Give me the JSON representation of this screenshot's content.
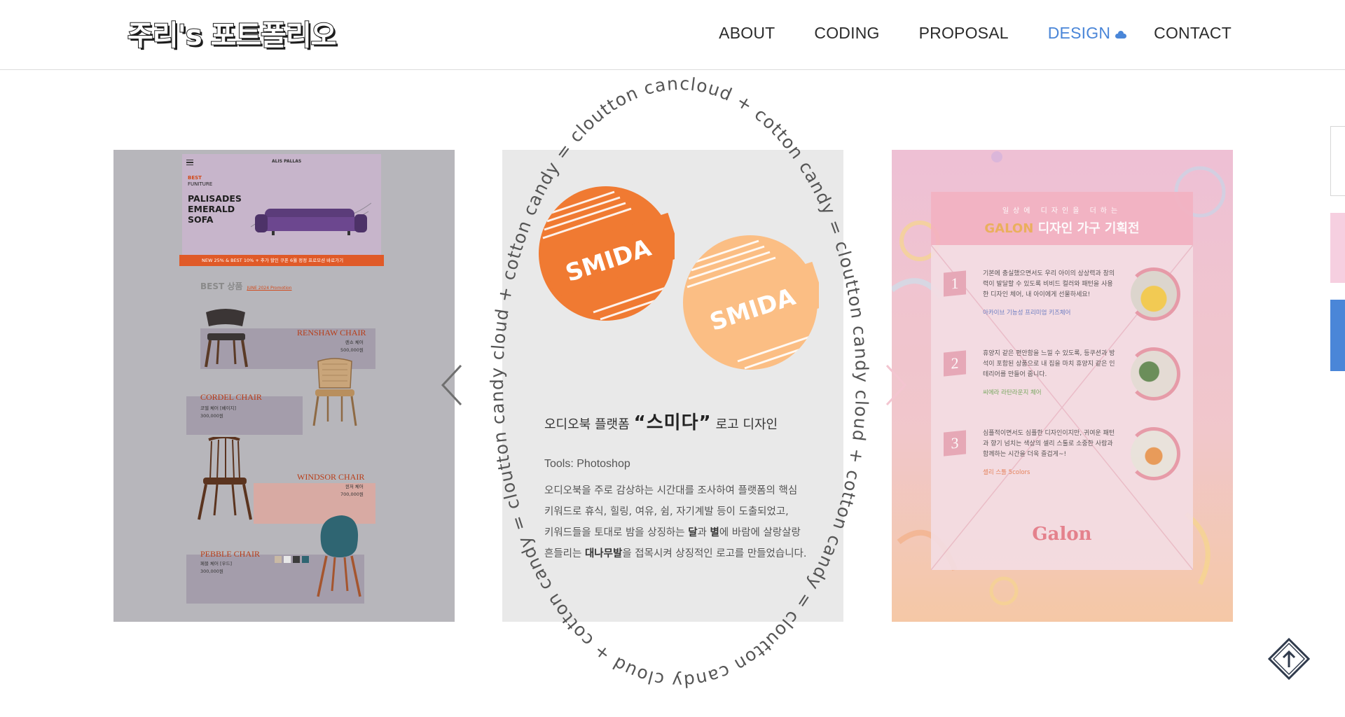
{
  "header": {
    "logo_text": "주리's 포트폴리오",
    "nav": [
      {
        "label": "ABOUT",
        "active": false
      },
      {
        "label": "CODING",
        "active": false
      },
      {
        "label": "PROPOSAL",
        "active": false
      },
      {
        "label": "DESIGN",
        "active": true
      },
      {
        "label": "CONTACT",
        "active": false
      }
    ],
    "active_icon": "cloud-icon"
  },
  "colors": {
    "accent": "#4a86d8",
    "smida_orange": "#f07a32",
    "smida_light": "#fbbe84"
  },
  "slides": {
    "left": {
      "best_label": "BEST",
      "best_sub": "FUNITURE",
      "brand": "ALIS PALLAS",
      "headline": [
        "PALISADES",
        "EMERALD",
        "SOFA"
      ],
      "promo_bar": "NEW 25% & BEST 10% + 추가 할인 쿠폰     6월 정정 프로모션 바로가기",
      "section_title": "BEST 상품",
      "section_link": "JUNE 2024 Promotion",
      "chairs": [
        {
          "name": "RENSHAW CHAIR",
          "kr": "렌쇼 체어",
          "price": "500,000원"
        },
        {
          "name": "CORDEL CHAIR",
          "kr": "코델 체어 [베이지]",
          "price": "300,000원"
        },
        {
          "name": "WINDSOR CHAIR",
          "kr": "윈저 체어",
          "price": "700,000원"
        },
        {
          "name": "PEBBLE CHAIR",
          "kr": "페블 체어 [우드]",
          "price": "300,000원"
        }
      ]
    },
    "center": {
      "logo_word": "SMIDA",
      "title_pre": "오디오북 플랫폼",
      "title_big": "“스미다”",
      "title_post": "로고 디자인",
      "tools": "Tools: Photoshop",
      "desc_lines": [
        "오디오북을 주로 감상하는 시간대를 조사하여 플랫폼의 핵심",
        "키워드로 휴식, 힐링, 여유, 쉼, 자기계발 등이 도출되었고,",
        [
          "키워드들을 토대로 밤을 상징하는 ",
          "달",
          "과 ",
          "별",
          "에 바람에 살랑살랑"
        ],
        [
          "흔들리는 ",
          "대나무발",
          "을 접목시켜 상징적인 로고를 만들었습니다."
        ]
      ],
      "ring_text": "cloud + cotton candy = cloutton candy    cloud + cotton candy = cloutton candy    cloud + cotton candy = cloutton candy    cloud + cotton candy = cloutton candy"
    },
    "right": {
      "eyebrow": "일상에 디자인을 더하는",
      "title_brand": "GALON",
      "title_rest": "디자인 가구 기획전",
      "items": [
        {
          "num": "1",
          "text": "기본에 충실했으면서도 우리 아이의 상상력과 창의력이 발달할 수 있도록 비비드 컬러와 패턴을 사용한 디자인 체어, 내 아이에게 선물하세요!",
          "tag": "아카이브 기능성 프리미엄 키즈체어",
          "tag_color": "#4a63b8"
        },
        {
          "num": "2",
          "text": "휴양지 같은 편안함을 느낄 수 있도록, 등쿠션과 방석이 포함된 상품으로 내 집을 마치 휴양지 같은 인테리어를 만들어 줍니다.",
          "tag": "씨에라 라탄라운지 체어",
          "tag_color": "#5a9a40"
        },
        {
          "num": "3",
          "text": "심플적이면서도 심플한 디자인이지만, 귀여운 패턴과 향기 넘치는 색상의 셀리 스툴로 소중한 사람과 함께하는 시간을 더욱 즐겁게~!",
          "tag": "셀리 스툴 5colors",
          "tag_color": "#e06a3a"
        }
      ],
      "logo": "Galon"
    }
  },
  "controls": {
    "prev_icon": "chevron-left-icon",
    "next_icon": "chevron-right-icon",
    "to_top_icon": "arrow-up-diamond-icon"
  }
}
